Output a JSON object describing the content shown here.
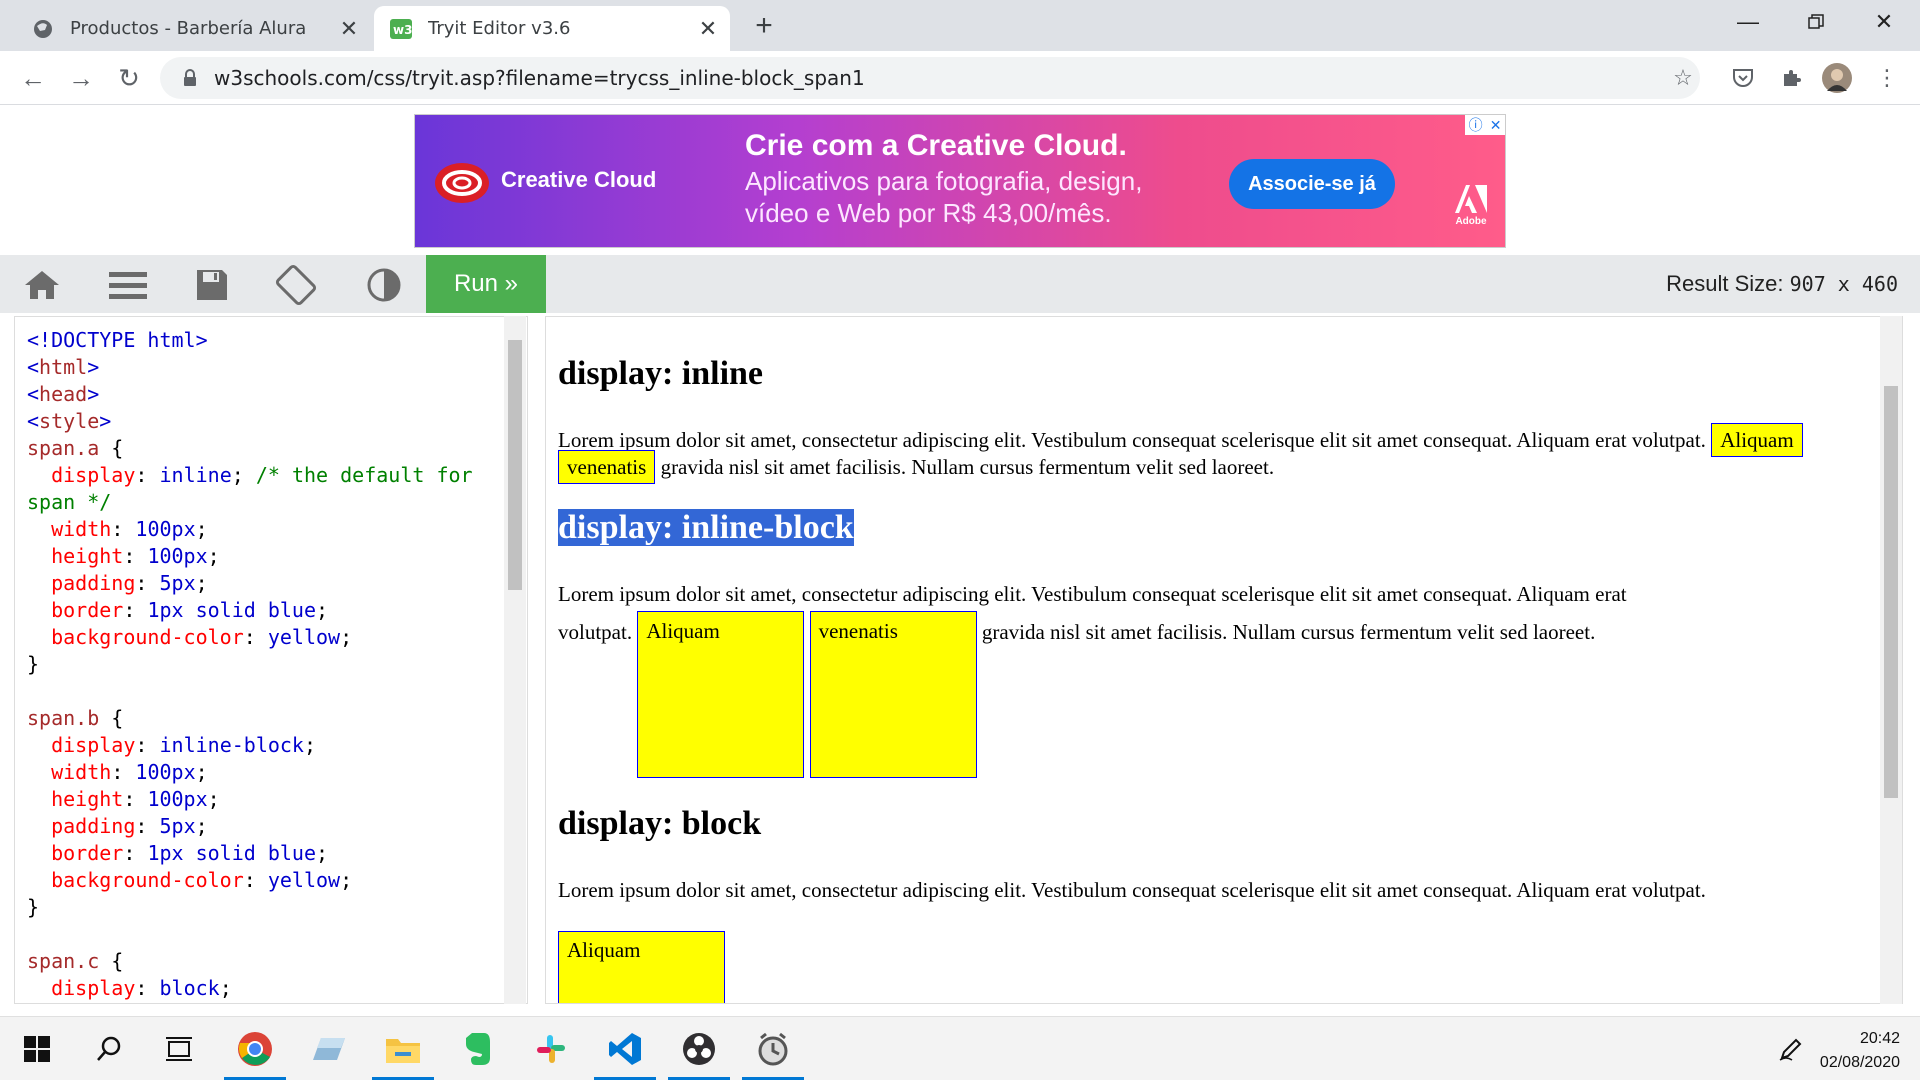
{
  "browser": {
    "tabs": [
      {
        "title": "Productos - Barbería Alura",
        "active": false
      },
      {
        "title": "Tryit Editor v3.6",
        "active": true
      }
    ],
    "url": "w3schools.com/css/tryit.asp?filename=trycss_inline-block_span1"
  },
  "ad": {
    "brand": "Creative Cloud",
    "headline": "Crie com a Creative Cloud.",
    "subline": "Aplicativos para fotografia, design, vídeo e Web por R$ 43,00/mês.",
    "cta": "Associe-se já",
    "logo_text": "Adobe"
  },
  "toolbar": {
    "run_label": "Run »",
    "result_label": "Result Size:",
    "result_size": "907 x 460"
  },
  "result": {
    "h_inline": "display: inline",
    "h_inline_block": "display: inline-block",
    "h_block": "display: block",
    "lorem": "Lorem ipsum dolor sit amet, consectetur adipiscing elit. Vestibulum consequat scelerisque elit sit amet consequat. Aliquam erat volutpat.",
    "lorem_start": "Lorem ipsum dolor sit amet, consectetur adipiscing elit. Vestibulum consequat scelerisque elit sit amet consequat. Aliquam erat",
    "lorem_end": "volutpat.",
    "span1": "Aliquam",
    "span2": "venenatis",
    "tail": "gravida nisl sit amet facilisis. Nullam cursus fermentum velit sed laoreet."
  },
  "taskbar": {
    "time": "20:42",
    "date": "02/08/2020"
  }
}
